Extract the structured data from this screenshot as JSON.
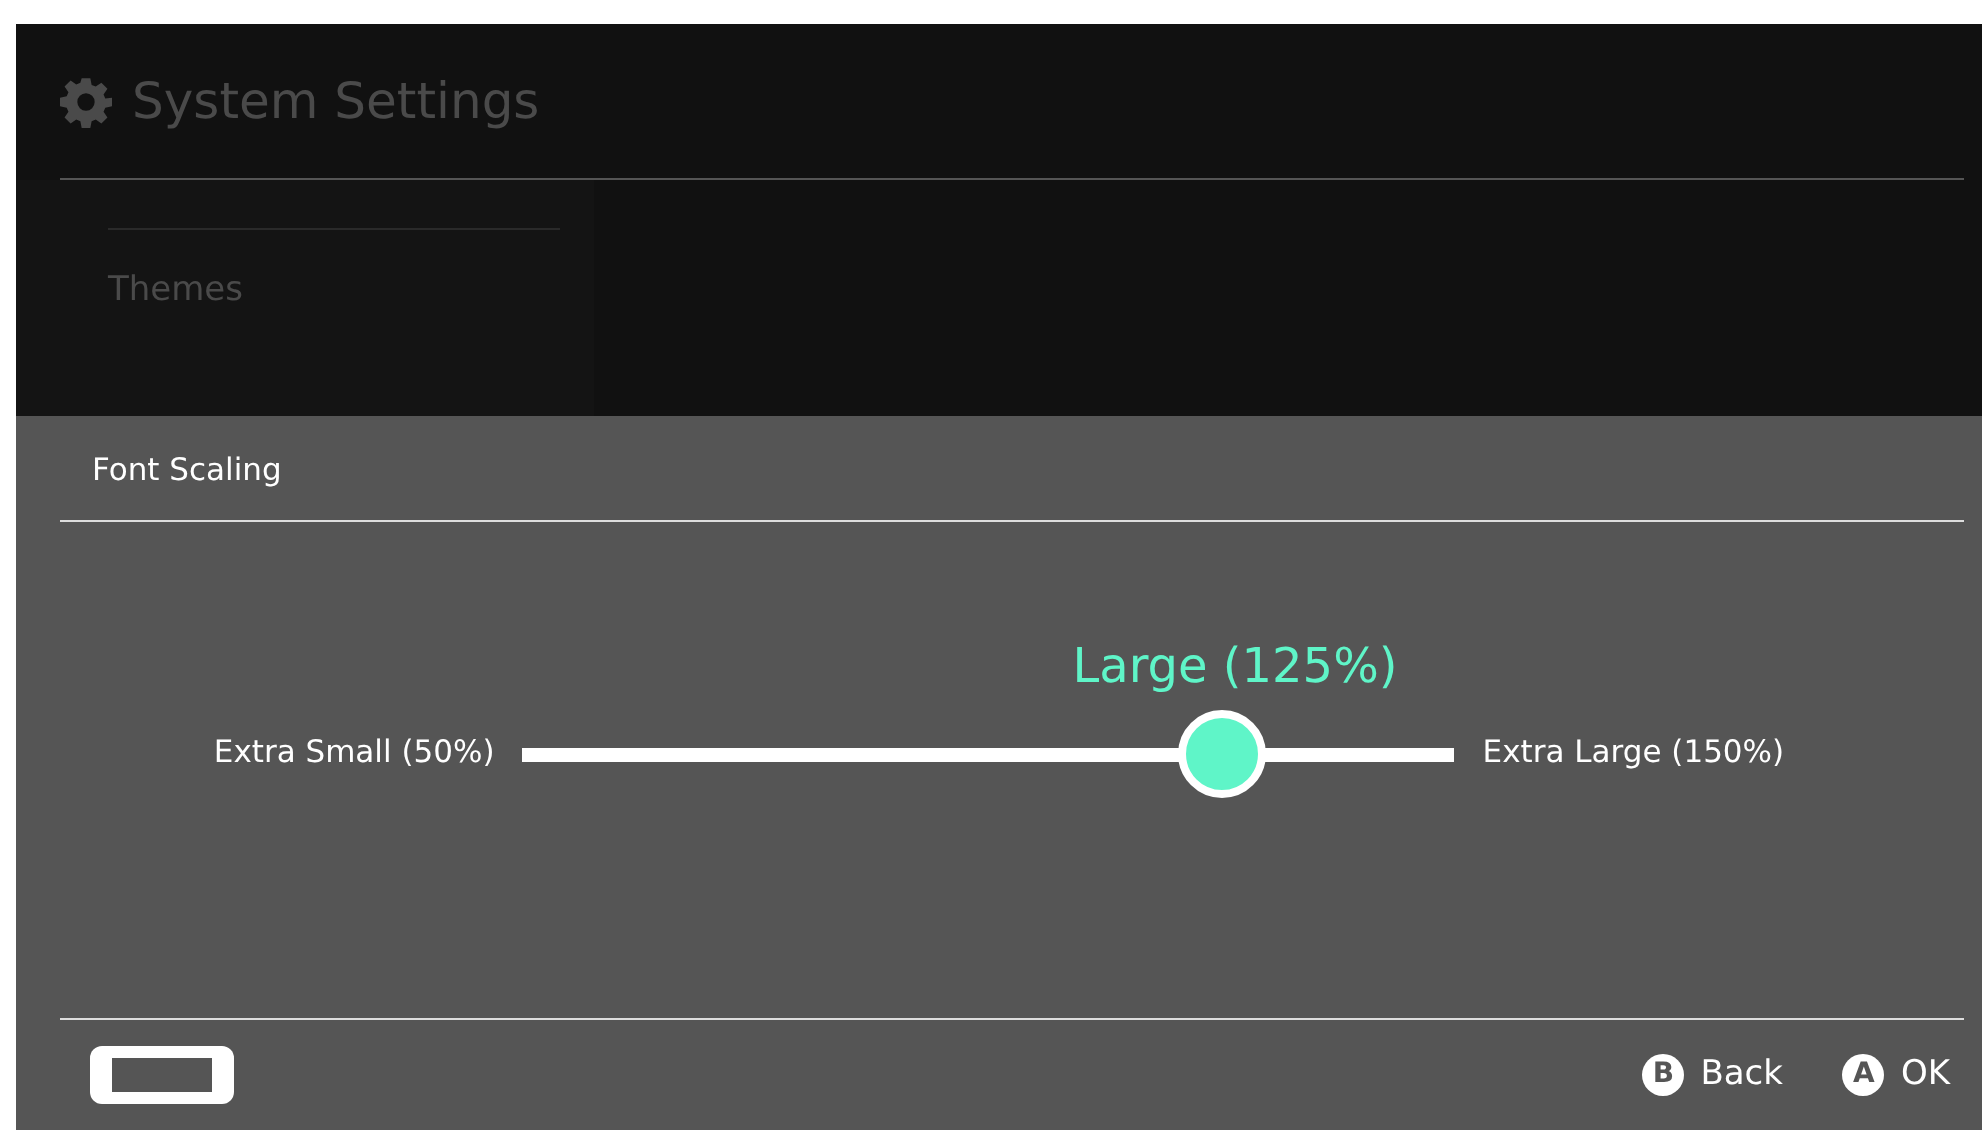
{
  "header": {
    "title": "System Settings"
  },
  "sidebar": {
    "items": [
      {
        "label": "Themes"
      }
    ]
  },
  "dialog": {
    "title": "Font Scaling",
    "slider": {
      "value_label": "Large (125%)",
      "min_label": "Extra Small (50%)",
      "max_label": "Extra Large (150%)",
      "level": 0.75
    },
    "footer": {
      "buttons": [
        {
          "glyph": "B",
          "label": "Back"
        },
        {
          "glyph": "A",
          "label": "OK"
        }
      ]
    }
  }
}
